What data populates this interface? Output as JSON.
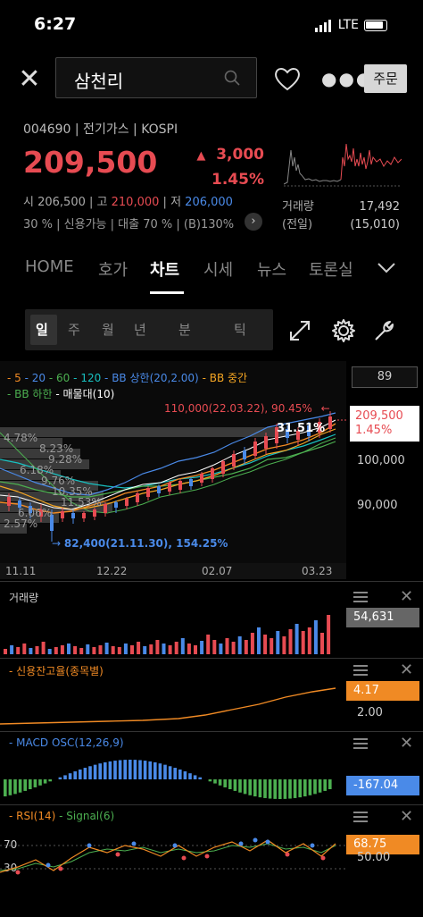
{
  "status": {
    "time": "6:27",
    "network": "LTE"
  },
  "search": {
    "query": "삼천리"
  },
  "header": {
    "order_label": "주문"
  },
  "stock": {
    "code_line": "004690 | 전기가스 | KOSPI",
    "price": "209,500",
    "change": "3,000",
    "change_pct": "1.45%",
    "open_label": "시",
    "open": "206,500",
    "high_label": "고",
    "high": "210,000",
    "low_label": "저",
    "low": "206,000",
    "credit_line": "30 % | 신용가능 | 대출 70 % | (B)130%",
    "volume_label": "거래량",
    "volume": "17,492",
    "prev_label": "(전일)",
    "prev_volume": "(15,010)"
  },
  "tabs": [
    "HOME",
    "호가",
    "차트",
    "시세",
    "뉴스",
    "토론실"
  ],
  "periods": [
    "일",
    "주",
    "월",
    "년",
    "분",
    "틱"
  ],
  "chart": {
    "legend": [
      "5",
      "20",
      "60",
      "120",
      "BB 상한(20,2.00)",
      "BB 중간"
    ],
    "legend2": [
      "BB 하한",
      "매물대(10)"
    ],
    "period_input": "89",
    "current_price": "209,500",
    "current_pct": "1.45%",
    "y_ticks": [
      "100,000",
      "90,000"
    ],
    "max_note": "110,000(22.03.22), 90.45%",
    "min_note": "82,400(21.11.30), 154.25%",
    "profile_labels": [
      "4.78%",
      "8.23%",
      "9.28%",
      "6.18%",
      "9.76%",
      "10.35%",
      "11.53%",
      "6.06%",
      "2.57%"
    ],
    "profile_top": "31.51%",
    "x_ticks": [
      "11.11",
      "12.22",
      "02.07",
      "03.23"
    ],
    "colors": {
      "ma5": "#f08a24",
      "ma20": "#4a8ae8",
      "ma60": "#4caf50",
      "ma120": "#18c0c0",
      "bb": "#f5a623",
      "white": "#ffffff",
      "up": "#e74b52",
      "down": "#4a8ae8"
    }
  },
  "panels": {
    "volume": {
      "title": "거래량",
      "value": "54,631"
    },
    "credit": {
      "title": "신용잔고율(종목별)",
      "value": "4.17",
      "tick": "2.00"
    },
    "macd": {
      "title": "MACD OSC(12,26,9)",
      "value": "-167.04"
    },
    "rsi": {
      "title": "RSI(14)",
      "title2": "Signal(6)",
      "value": "68.75",
      "ticks": [
        "70",
        "30"
      ],
      "right_tick": "50.00"
    }
  }
}
